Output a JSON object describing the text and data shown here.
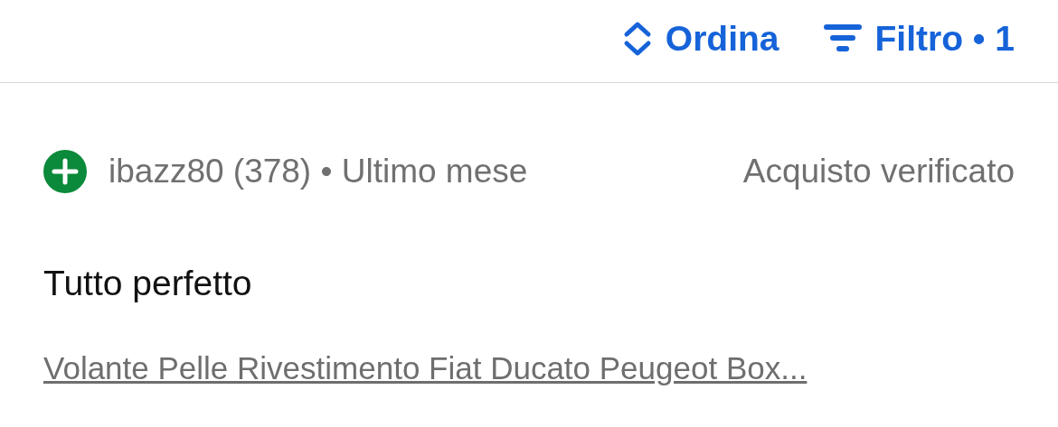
{
  "toolbar": {
    "sort": {
      "label": "Ordina"
    },
    "filter": {
      "label": "Filtro • 1"
    }
  },
  "review": {
    "author": "ibazz80 (378) • Ultimo mese",
    "verified": "Acquisto verificato",
    "title": "Tutto perfetto",
    "item_link": "Volante Pelle Rivestimento Fiat Ducato Peugeot Box..."
  }
}
